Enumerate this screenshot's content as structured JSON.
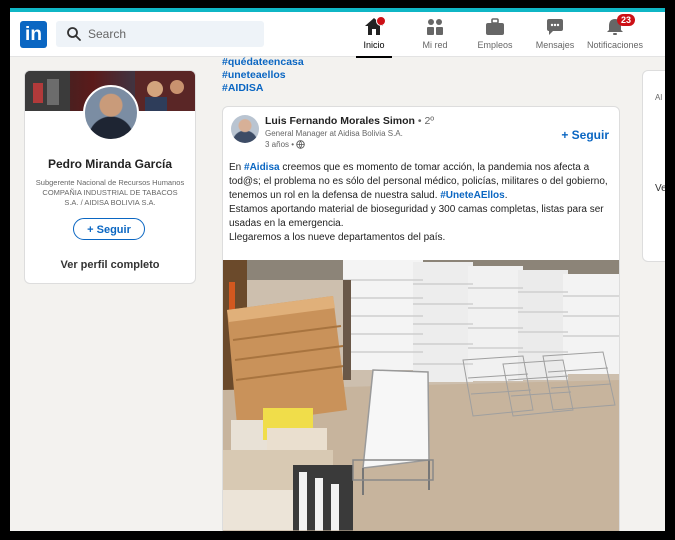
{
  "app": {
    "logo_text": "in",
    "accent": "#0a66c2"
  },
  "search": {
    "placeholder": "Search"
  },
  "nav": {
    "items": [
      {
        "label": "Inicio",
        "icon": "home-icon",
        "active": true
      },
      {
        "label": "Mi red",
        "icon": "network-icon"
      },
      {
        "label": "Empleos",
        "icon": "briefcase-icon"
      },
      {
        "label": "Mensajes",
        "icon": "messages-icon"
      },
      {
        "label": "Notificaciones",
        "icon": "bell-icon",
        "badge": "23"
      }
    ]
  },
  "profile": {
    "name": "Pedro Miranda García",
    "headline": "Subgerente Nacional de Recursos Humanos COMPAÑIA INDUSTRIAL DE TABACOS S.A. / AIDISA BOLIVIA S.A.",
    "follow_label": "+ Seguir",
    "view_profile": "Ver perfil completo"
  },
  "feed": {
    "hashtags": [
      "#quédateencasa",
      "#uneteaellos",
      "#AIDISA"
    ]
  },
  "post": {
    "author_name": "Luis Fernando Morales Simon",
    "author_degree": " • 2º",
    "author_title": "General Manager at Aidisa Bolivia S.A.",
    "time": "3 años •",
    "follow_label": "+ Seguir",
    "text": {
      "p1_pre": "En ",
      "p1_tag": "#Aidisa",
      "p1_mid": " creemos que es momento de tomar acción, la pandemia nos afecta a tod@s; el problema no es sólo del personal médico, policías, militares o del gobierno, tenemos un rol en la defensa de nuestra salud. ",
      "p1_tag2": "#UneteAEllos",
      "p1_post": ".",
      "p2": "Estamos aportando material de bioseguridad y 300 camas completas, listas para ser usadas en la emergencia.",
      "p3": "Llegaremos a los nueve departamentos del país."
    }
  },
  "right_panel": {
    "text_top": "Al",
    "text_mid": "Ve"
  }
}
